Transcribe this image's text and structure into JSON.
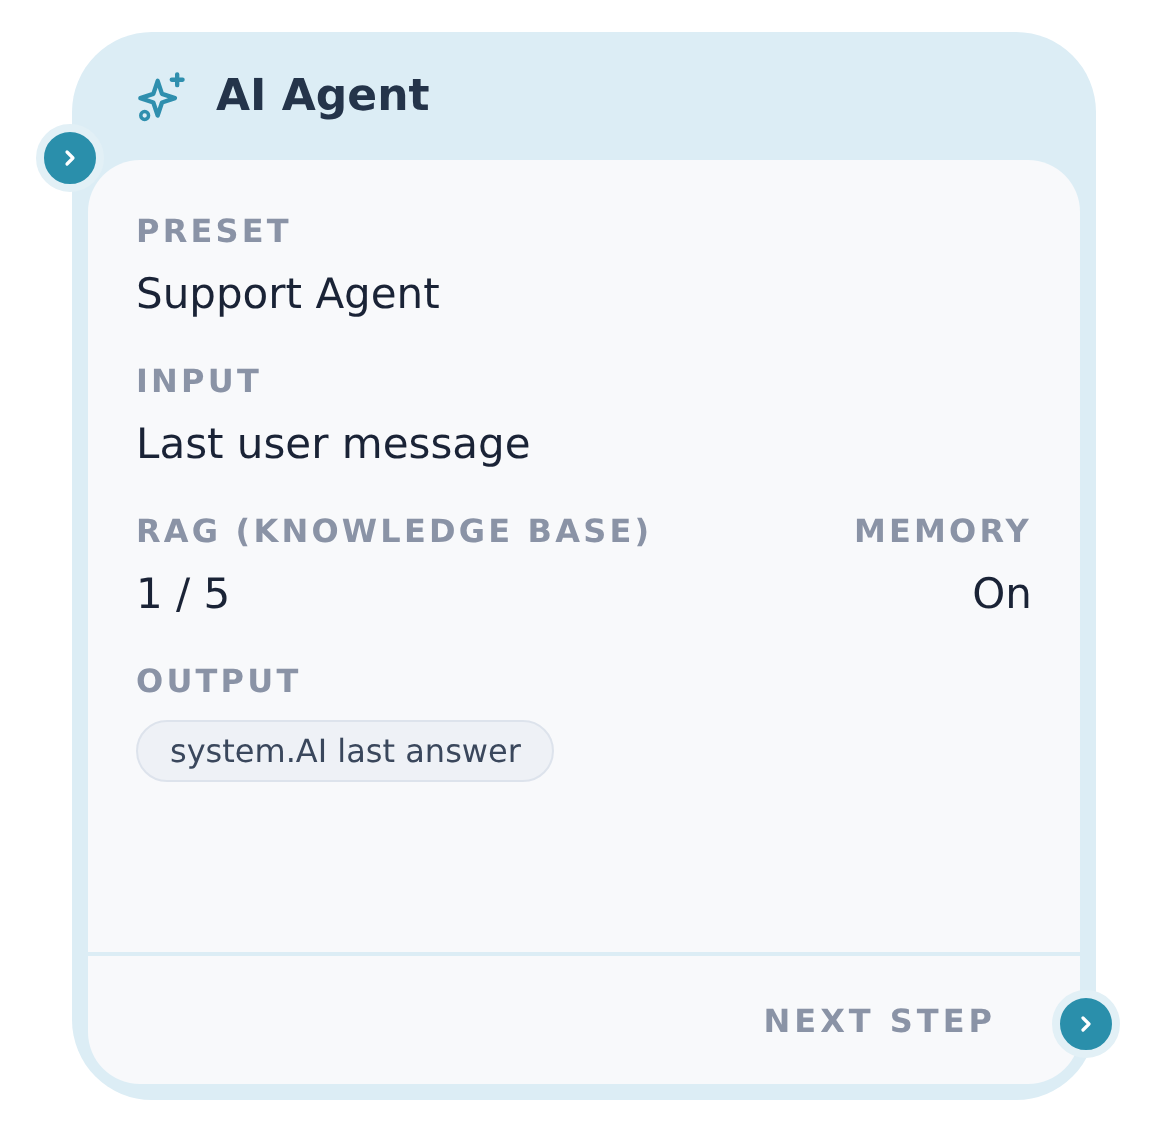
{
  "node": {
    "title": "AI Agent"
  },
  "fields": [
    {
      "label": "PRESET",
      "value": "Support Agent"
    },
    {
      "label": "INPUT",
      "value": "Last user message"
    }
  ],
  "pair": [
    {
      "label": "RAG (KNOWLEDGE BASE)",
      "value": "1 / 5"
    },
    {
      "label": "MEMORY",
      "value": "On"
    }
  ],
  "output": {
    "label": "OUTPUT",
    "chip": "system.AI last answer"
  },
  "footer": {
    "label": "NEXT STEP"
  }
}
